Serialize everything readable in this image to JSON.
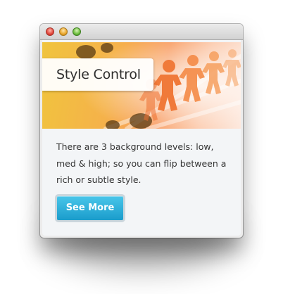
{
  "window": {
    "controls": [
      "close-button",
      "minimize-button",
      "zoom-button"
    ]
  },
  "card": {
    "title": "Style Control",
    "description": "There are 3 background levels: low, med & high; so you can flip between a rich or subtle style.",
    "button_label": "See More"
  },
  "colors": {
    "button_top": "#49c6ea",
    "button_bottom": "#1a9ccb",
    "content_bg": "#f3f5f7",
    "hero_warm": "#f5b24a"
  }
}
